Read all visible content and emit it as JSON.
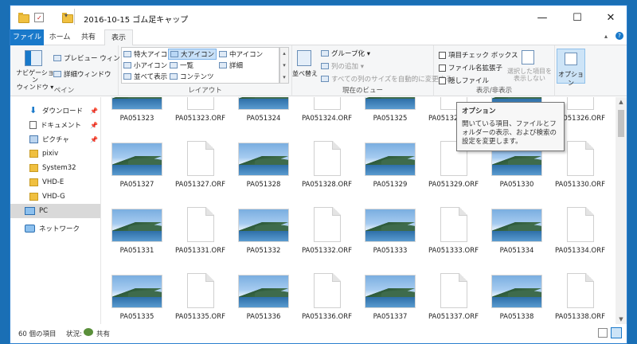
{
  "window": {
    "title": "2016-10-15 ゴム足キャップ",
    "controls": {
      "minimize": "—",
      "maximize": "☐",
      "close": "✕"
    }
  },
  "ribbon_tabs": [
    {
      "label": "ファイル"
    },
    {
      "label": "ホーム"
    },
    {
      "label": "共有"
    },
    {
      "label": "表示"
    }
  ],
  "ribbon": {
    "pane": {
      "nav_pane_label": "ナビゲーション\nウィンドウ ▾",
      "preview_label": "プレビュー ウィンドウ",
      "details_label": "詳細ウィンドウ",
      "group_label": "ペイン"
    },
    "layout": {
      "options": [
        "特大アイコン",
        "大アイコン",
        "中アイコン",
        "小アイコン",
        "一覧",
        "詳細",
        "並べて表示",
        "コンテンツ"
      ],
      "selected": "大アイコン",
      "group_label": "レイアウト"
    },
    "current_view": {
      "sort_label": "並べ替え",
      "group_by_label": "グループ化 ▾",
      "add_column_label": "列の追加 ▾",
      "autosize_label": "すべての列のサイズを自動的に変更する",
      "group_label": "現在のビュー"
    },
    "show_hide": {
      "item_checkboxes": "項目チェック ボックス",
      "file_extensions": "ファイル名拡張子",
      "hidden_items": "隠しファイル",
      "hide_selected_label": "選択した項目を\n表示しない",
      "group_label": "表示/非表示"
    },
    "options_label": "オプション"
  },
  "nav": {
    "items": [
      {
        "label": "ダウンロード",
        "pinned": true
      },
      {
        "label": "ドキュメント",
        "pinned": true
      },
      {
        "label": "ピクチャ",
        "pinned": true
      },
      {
        "label": "pixiv"
      },
      {
        "label": "System32"
      },
      {
        "label": "VHD-E"
      },
      {
        "label": "VHD-G"
      },
      {
        "label": "PC",
        "selected": true
      },
      {
        "label": "ネットワーク"
      }
    ]
  },
  "files": [
    [
      "PA051323",
      "PA051323.ORF",
      "PA051324",
      "PA051324.ORF",
      "PA051325",
      "PA051325.ORF",
      "PA051326",
      "PA051326.ORF"
    ],
    [
      "PA051327",
      "PA051327.ORF",
      "PA051328",
      "PA051328.ORF",
      "PA051329",
      "PA051329.ORF",
      "PA051330",
      "PA051330.ORF"
    ],
    [
      "PA051331",
      "PA051331.ORF",
      "PA051332",
      "PA051332.ORF",
      "PA051333",
      "PA051333.ORF",
      "PA051334",
      "PA051334.ORF"
    ],
    [
      "PA051335",
      "PA051335.ORF",
      "PA051336",
      "PA051336.ORF",
      "PA051337",
      "PA051337.ORF",
      "PA051338",
      "PA051338.ORF"
    ]
  ],
  "tooltip": {
    "title": "オプション",
    "body": "開いている項目、ファイルとフォルダーの表示、および検索の設定を変更します。"
  },
  "status": {
    "item_count": "60 個の項目",
    "state_label": "状況:",
    "state_value": "共有"
  }
}
